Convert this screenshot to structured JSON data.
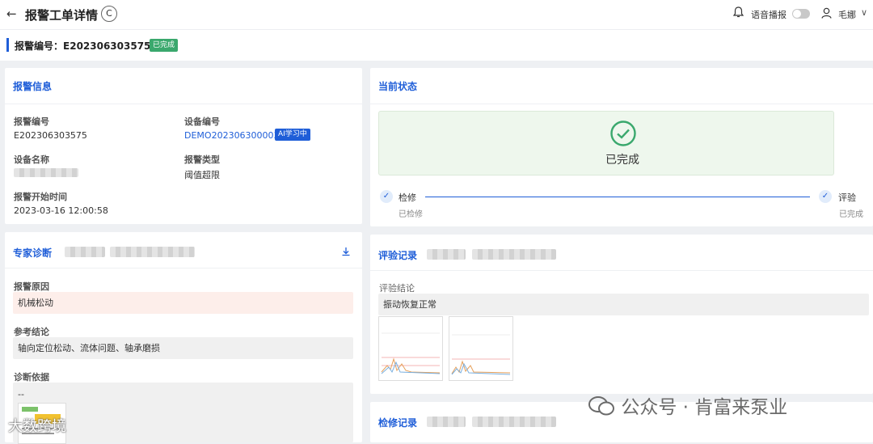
{
  "header": {
    "back_icon": "arrow-left-icon",
    "title": "报警工单详情",
    "refresh_glyph": "C",
    "voice_label": "语音播报",
    "voice_on": false,
    "user_name": "毛娜"
  },
  "order": {
    "label": "报警编号：",
    "number": "E202306303575",
    "status": "已完成"
  },
  "alarm_info": {
    "title": "报警信息",
    "alarm_no_label": "报警编号",
    "alarm_no": "E202306303575",
    "device_no_label": "设备编号",
    "device_no": "DEMO202306300003",
    "ai_badge": "AI学习中",
    "device_name_label": "设备名称",
    "alarm_type_label": "报警类型",
    "alarm_type": "阈值超限",
    "start_time_label": "报警开始时间",
    "start_time": "2023-03-16 12:00:58"
  },
  "current_status": {
    "title": "当前状态",
    "status_text": "已完成",
    "steps": [
      {
        "label": "检修",
        "sub": "已检修"
      },
      {
        "label": "评验",
        "sub": "已完成"
      }
    ]
  },
  "expert": {
    "title": "专家诊断",
    "reason_label": "报警原因",
    "reason": "机械松动",
    "conclusion_label": "参考结论",
    "conclusion": "轴向定位松动、流体问题、轴承磨损",
    "basis_label": "诊断依据",
    "basis": "--"
  },
  "evaluation": {
    "title": "评验记录",
    "conclusion_label": "评验结论",
    "conclusion": "振动恢复正常"
  },
  "repair": {
    "title": "检修记录"
  },
  "watermark": {
    "text": "公众号 · 肯富来泵业",
    "text2": "大数跨境"
  },
  "colors": {
    "accent": "#1f5ed8",
    "success": "#3aa86d",
    "reason_bg": "#fdeeea",
    "status_bg": "#eef7ed"
  }
}
